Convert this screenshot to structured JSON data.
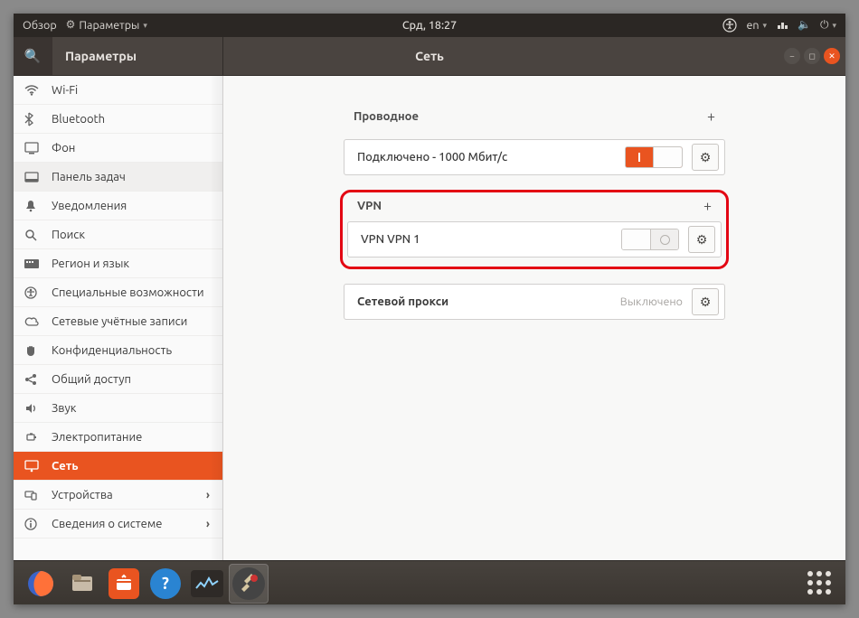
{
  "top_panel": {
    "overview": "Обзор",
    "app_menu": "Параметры",
    "clock": "Срд, 18:27",
    "lang": "en"
  },
  "headerbar": {
    "search_icon": "search",
    "left_title": "Параметры",
    "center_title": "Сеть"
  },
  "sidebar": {
    "items": [
      {
        "key": "wifi",
        "icon": "wifi",
        "label": "Wi-Fi"
      },
      {
        "key": "bluetooth",
        "icon": "bt",
        "label": "Bluetooth"
      },
      {
        "key": "background",
        "icon": "display",
        "label": "Фон"
      },
      {
        "key": "dock",
        "icon": "dock",
        "label": "Панель задач"
      },
      {
        "key": "notif",
        "icon": "bell",
        "label": "Уведомления"
      },
      {
        "key": "search",
        "icon": "search",
        "label": "Поиск"
      },
      {
        "key": "region",
        "icon": "region",
        "label": "Регион и язык"
      },
      {
        "key": "a11y",
        "icon": "a11y",
        "label": "Специальные возможности"
      },
      {
        "key": "accounts",
        "icon": "cloud",
        "label": "Сетевые учётные записи"
      },
      {
        "key": "privacy",
        "icon": "hand",
        "label": "Конфиденциальность"
      },
      {
        "key": "sharing",
        "icon": "share",
        "label": "Общий доступ"
      },
      {
        "key": "sound",
        "icon": "sound",
        "label": "Звук"
      },
      {
        "key": "power",
        "icon": "power",
        "label": "Электропитание"
      },
      {
        "key": "network",
        "icon": "net",
        "label": "Сеть",
        "selected": true
      },
      {
        "key": "devices",
        "icon": "devices",
        "label": "Устройства",
        "chevron": true
      },
      {
        "key": "about",
        "icon": "about",
        "label": "Сведения о системе",
        "chevron": true
      }
    ]
  },
  "network": {
    "wired": {
      "title": "Проводное",
      "status": "Подключено - 1000 Мбит/с",
      "toggle_on": true
    },
    "vpn": {
      "title": "VPN",
      "name": "VPN VPN 1",
      "toggle_on": false
    },
    "proxy": {
      "title": "Сетевой прокси",
      "status": "Выключено"
    }
  },
  "dock": {
    "apps": [
      {
        "key": "firefox",
        "glyph": "firefox"
      },
      {
        "key": "files",
        "glyph": "files"
      },
      {
        "key": "software",
        "glyph": "software"
      },
      {
        "key": "help",
        "glyph": "help"
      },
      {
        "key": "monitor",
        "glyph": "monitor"
      },
      {
        "key": "tweaks",
        "glyph": "tweaks",
        "active": true
      }
    ]
  },
  "icons": {
    "wifi": "≋",
    "bt": "✱",
    "display": "▢",
    "dock": "▭",
    "bell": "🔔",
    "search": "🔍",
    "region": "🌐",
    "a11y": "◉",
    "cloud": "☁",
    "hand": "✋",
    "share": "<",
    "sound": "🔈",
    "power": "⚡",
    "net": "🖧",
    "devices": "⌨",
    "about": "ℹ"
  }
}
